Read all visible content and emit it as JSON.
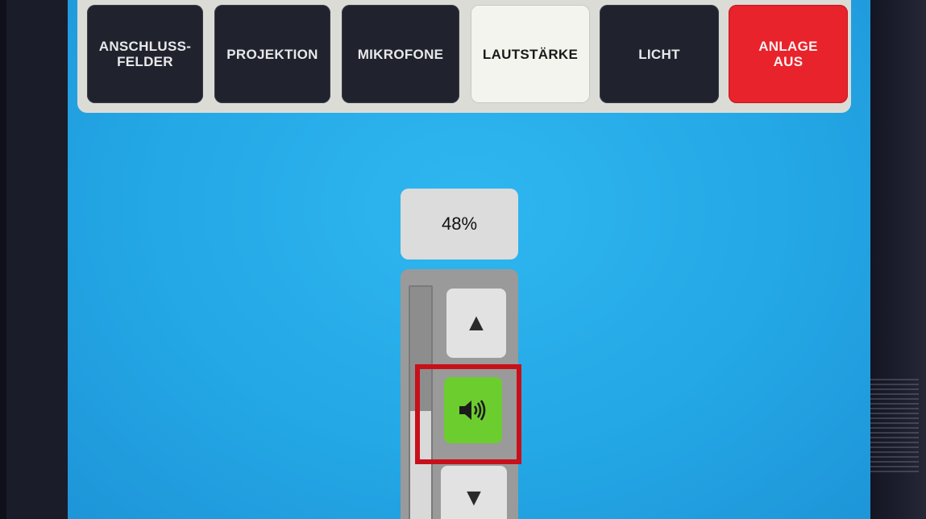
{
  "tabs": [
    {
      "label": "ANSCHLUSS-\nFELDER",
      "state": "normal"
    },
    {
      "label": "PROJEKTION",
      "state": "normal"
    },
    {
      "label": "MIKROFONE",
      "state": "normal"
    },
    {
      "label": "LAUTSTÄRKE",
      "state": "active"
    },
    {
      "label": "LICHT",
      "state": "normal"
    },
    {
      "label": "ANLAGE\nAUS",
      "state": "power"
    }
  ],
  "volume": {
    "value_text": "48%",
    "level": 0.48,
    "up_icon": "triangle-up-icon",
    "down_icon": "triangle-down-icon",
    "mute_icon": "speaker-icon"
  },
  "colors": {
    "screen_bg": "#24a8e6",
    "tab_dark": "#20232d",
    "tab_active": "#f4f4ee",
    "power_red": "#e8232b",
    "mute_green": "#6ccd2f",
    "highlight_red": "#c8101a"
  }
}
